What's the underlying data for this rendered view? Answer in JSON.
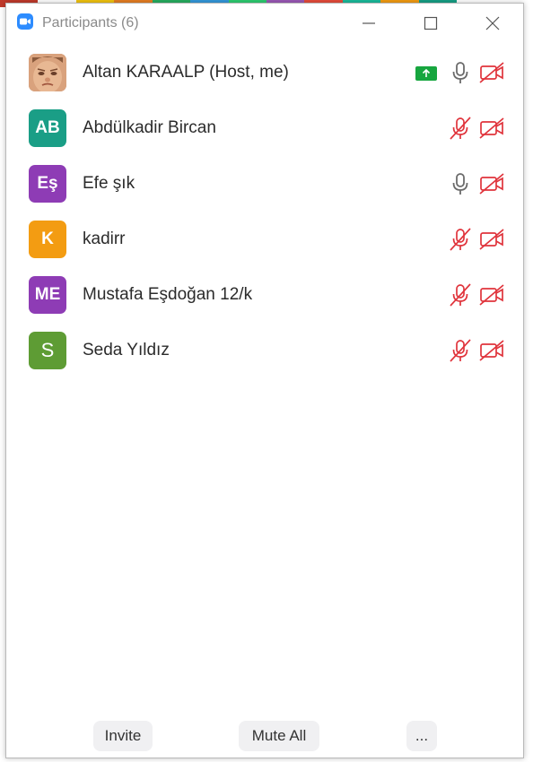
{
  "window": {
    "title": "Participants (6)",
    "app_icon": "zoom-video-icon",
    "controls": [
      "minimize-icon",
      "maximize-icon",
      "close-icon"
    ]
  },
  "colors": {
    "muted": "#e0343c",
    "unmuted_mic": "#6b6b6b",
    "share_badge": "#17a63f"
  },
  "participants": [
    {
      "name": "Altan KARAALP (Host, me)",
      "initials": "",
      "avatar": "photo",
      "avatar_color": "#c9906a",
      "mic": "on",
      "camera": "off",
      "sharing": true
    },
    {
      "name": "Abdülkadir Bircan",
      "initials": "AB",
      "avatar": "initials",
      "avatar_color": "#1a9e86",
      "mic": "muted",
      "camera": "off",
      "sharing": false
    },
    {
      "name": "Efe şık",
      "initials": "Eş",
      "avatar": "initials",
      "avatar_color": "#8e3cb5",
      "mic": "on",
      "camera": "off",
      "sharing": false
    },
    {
      "name": "kadirr",
      "initials": "K",
      "avatar": "initials",
      "avatar_color": "#f39c12",
      "mic": "muted",
      "camera": "off",
      "sharing": false
    },
    {
      "name": "Mustafa Eşdoğan 12/k",
      "initials": "ME",
      "avatar": "initials",
      "avatar_color": "#8e3cb5",
      "mic": "muted",
      "camera": "off",
      "sharing": false
    },
    {
      "name": "Seda Yıldız",
      "initials": "S",
      "avatar": "initials",
      "avatar_color": "#5e9c34",
      "mic": "muted",
      "camera": "off",
      "sharing": false
    }
  ],
  "footer": {
    "invite_label": "Invite",
    "mute_all_label": "Mute All",
    "more_label": "..."
  }
}
